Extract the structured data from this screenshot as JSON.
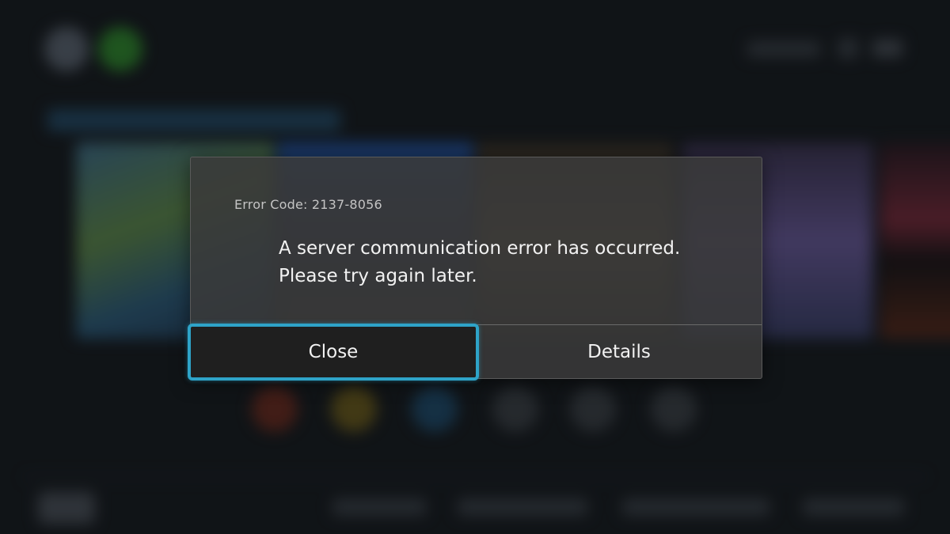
{
  "dialog": {
    "error_code": "Error Code: 2137-8056",
    "message_line1": "A server communication error has occurred.",
    "message_line2": "Please try again later.",
    "buttons": {
      "close": "Close",
      "details": "Details"
    }
  },
  "colors": {
    "focus_outline": "#2ea3c8",
    "dialog_background": "#3a3a3a",
    "text": "#f2f2f2"
  }
}
